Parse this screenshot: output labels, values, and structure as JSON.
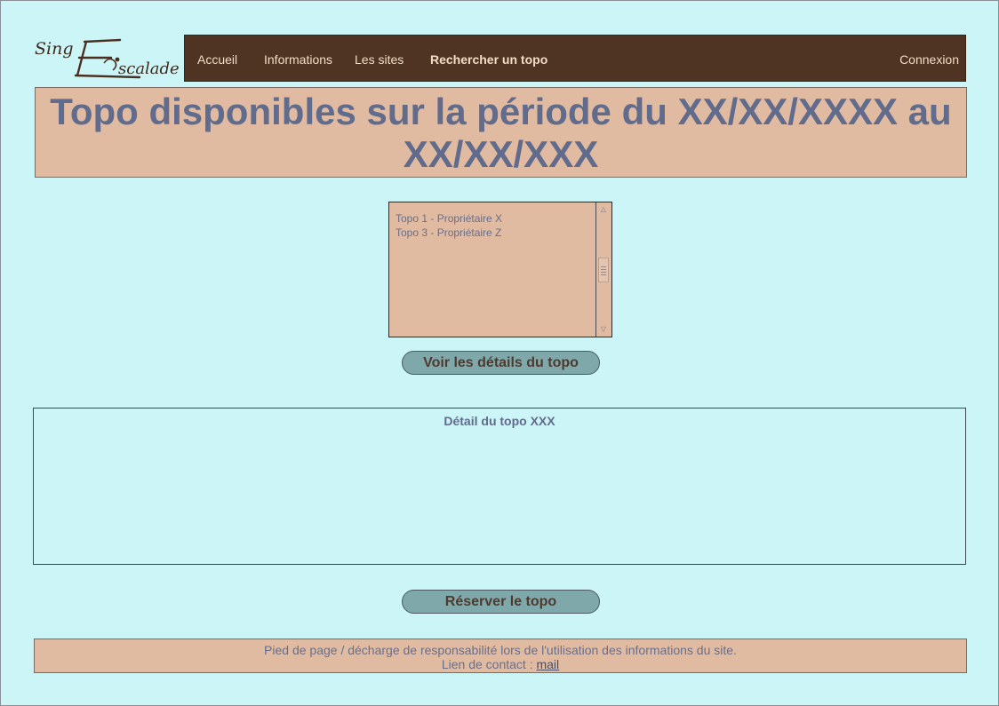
{
  "nav": {
    "accueil": "Accueil",
    "informations": "Informations",
    "sites": "Les sites",
    "rechercher": "Rechercher un topo",
    "connexion": "Connexion"
  },
  "title": "Topo disponibles sur la période du XX/XX/XXXX au XX/XX/XXX",
  "listbox": {
    "options": [
      "Topo 1 - Propriétaire X",
      "Topo 3 - Propriétaire Z"
    ]
  },
  "buttons": {
    "details": "Voir les détails du topo",
    "reserve": "Réserver le topo"
  },
  "detail": {
    "title": "Détail du topo XXX"
  },
  "footer": {
    "line1": "Pied de page / décharge de responsabilité lors de l'utilisation des informations du site.",
    "contact_prefix": "Lien de contact : ",
    "contact_link": "mail"
  },
  "colors": {
    "page_bg": "#ccf5f7",
    "nav_bg": "#4f3424",
    "panel_bg": "#e0bba2",
    "title_text": "#616b8c",
    "button_bg": "#7fa8aa"
  }
}
